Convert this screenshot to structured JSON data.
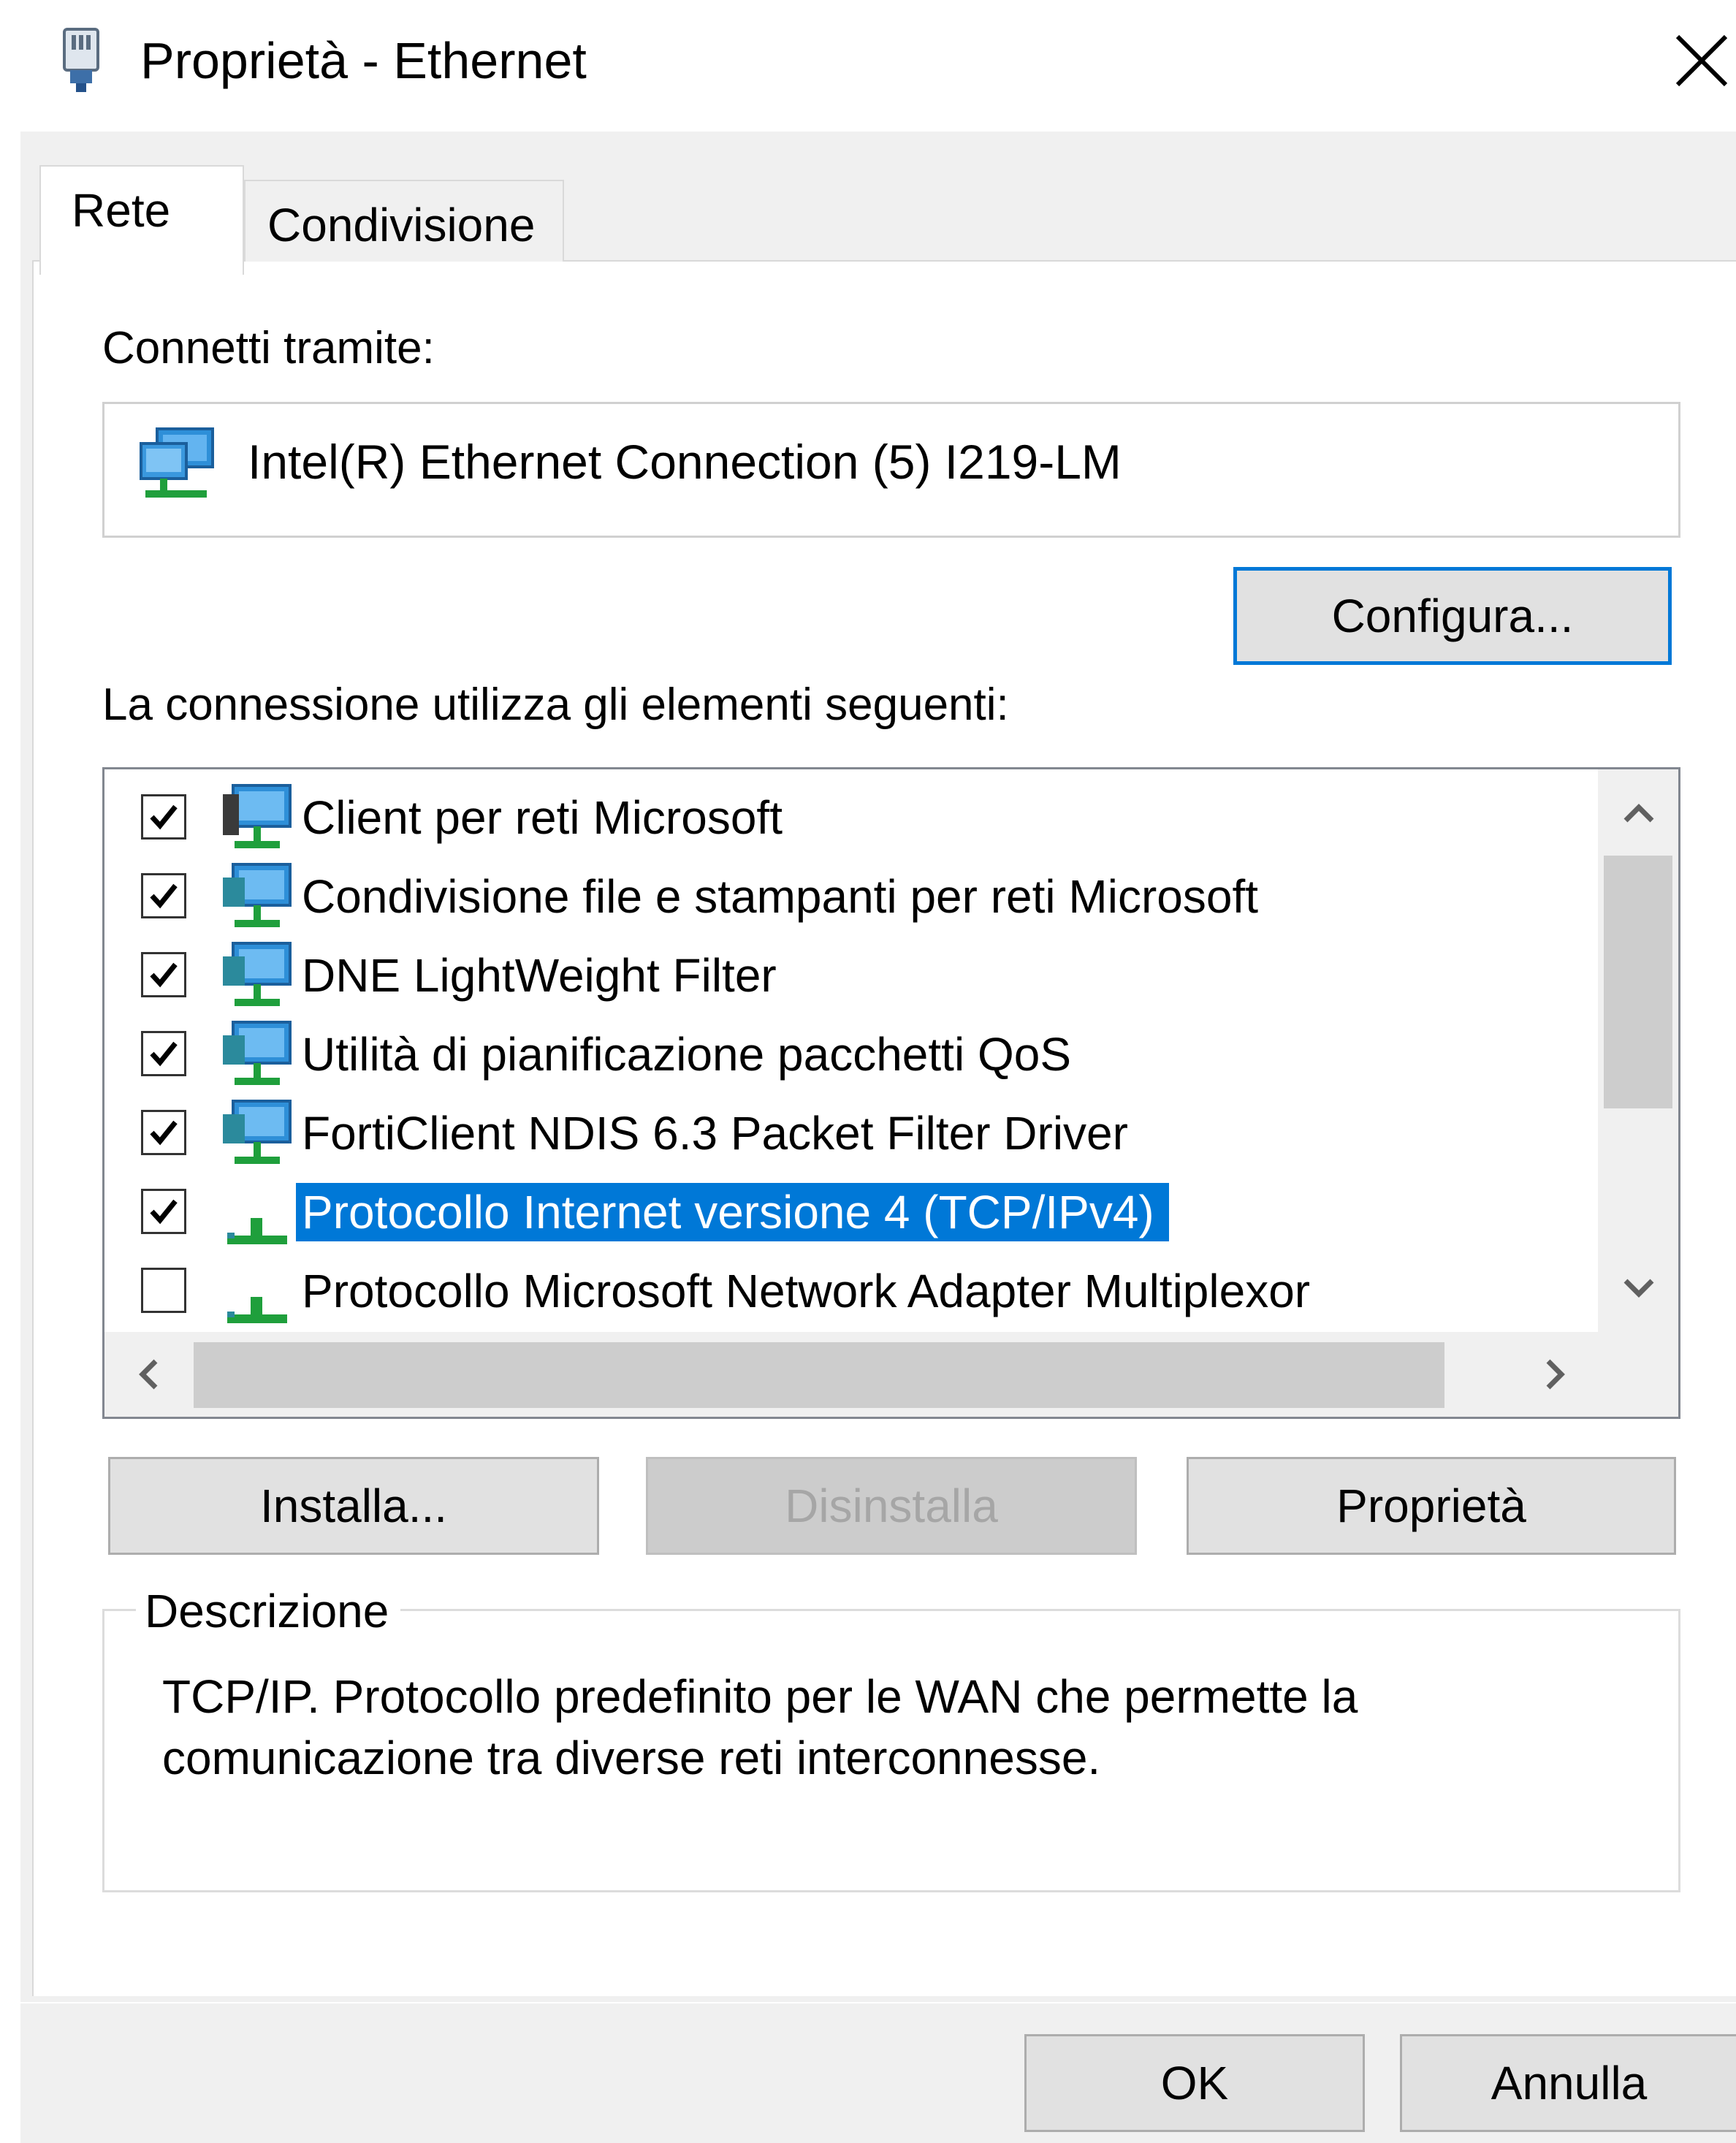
{
  "window": {
    "title": "Proprietà - Ethernet",
    "close_label": "×"
  },
  "tabs": [
    {
      "label": "Rete",
      "active": true
    },
    {
      "label": "Condivisione",
      "active": false
    }
  ],
  "connect_via": {
    "label": "Connetti tramite:",
    "adapter": "Intel(R) Ethernet Connection (5) I219-LM",
    "configure_button": "Configura..."
  },
  "components": {
    "label": "La connessione utilizza gli elementi seguenti:",
    "items": [
      {
        "label": "Client per reti Microsoft",
        "checked": true,
        "icon": "network-client-icon",
        "selected": false
      },
      {
        "label": "Condivisione file e stampanti per reti Microsoft",
        "checked": true,
        "icon": "network-service-icon",
        "selected": false
      },
      {
        "label": "DNE LightWeight Filter",
        "checked": true,
        "icon": "network-service-icon",
        "selected": false
      },
      {
        "label": "Utilità di pianificazione pacchetti QoS",
        "checked": true,
        "icon": "network-service-icon",
        "selected": false
      },
      {
        "label": "FortiClient NDIS 6.3 Packet Filter Driver",
        "checked": true,
        "icon": "network-service-icon",
        "selected": false
      },
      {
        "label": "Protocollo Internet versione 4 (TCP/IPv4)",
        "checked": true,
        "icon": "network-protocol-icon",
        "selected": true
      },
      {
        "label": "Protocollo Microsoft Network Adapter Multiplexor",
        "checked": false,
        "icon": "network-protocol-icon",
        "selected": false
      }
    ]
  },
  "actions": {
    "install": "Installa...",
    "uninstall": "Disinstalla",
    "properties": "Proprietà"
  },
  "description": {
    "legend": "Descrizione",
    "text": "TCP/IP. Protocollo predefinito per le WAN che permette la comunicazione tra diverse reti interconnesse."
  },
  "footer": {
    "ok": "OK",
    "cancel": "Annulla"
  },
  "colors": {
    "accent": "#0078d7",
    "selection_text": "#ffffff",
    "dialog_bg": "#f0f0f0",
    "icon_green": "#1f9f3c",
    "icon_blue": "#2e8fd8"
  }
}
